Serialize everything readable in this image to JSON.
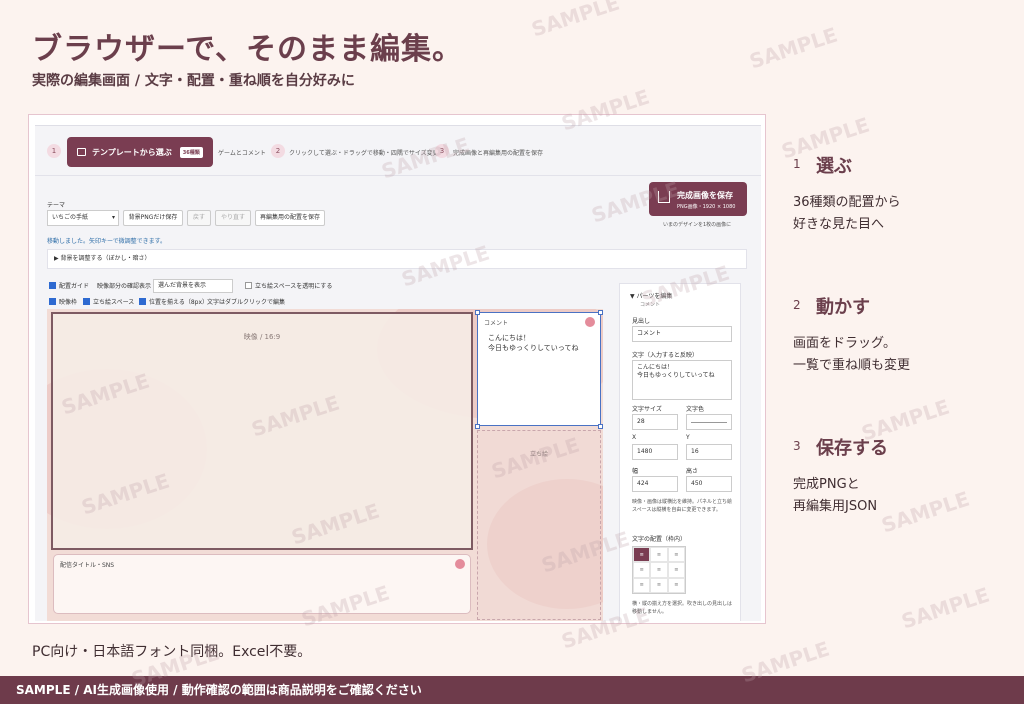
{
  "headline": "ブラウザーで、そのまま編集。",
  "subline": "実際の編集画面 / 文字・配置・重ね順を自分好みに",
  "app": {
    "steps": [
      {
        "num": "1",
        "label": "テンプレートから選ぶ",
        "badge": "36種類"
      },
      {
        "num": "",
        "label": "ゲームとコメント"
      },
      {
        "num": "2",
        "label": "クリックして選ぶ・ドラッグで移動・四隅でサイズ変更"
      },
      {
        "num": "3",
        "label": "完成画像と再編集用の配置を保存"
      }
    ],
    "theme_label": "テーマ",
    "theme_value": "いちごの手紙",
    "buttons": {
      "bg_png": "背景PNGだけ保存",
      "undo": "戻す",
      "redo": "やり直す",
      "save_layout": "再編集用の配置を保存"
    },
    "save_main": {
      "label": "完成画像を保存",
      "sub": "PNG画像・1920 × 1080",
      "note": "いまのデザインを1枚の画像に"
    },
    "moved_msg": "移動しました。矢印キーで微調整できます。",
    "bg_adjust": "▶ 背景を調整する（ぼかし・暗さ）",
    "options": {
      "guide": "配置ガイド",
      "preview_label": "映像部分の確認表示",
      "preview_value": "選んだ背景を表示",
      "transparent": "立ち絵スペースを透明にする",
      "video_frame": "映像枠",
      "stand_space": "立ち絵スペース",
      "align": "位置を揃える（8px）",
      "dblclick_hint": "文字はダブルクリックで編集"
    },
    "canvas": {
      "video_label": "映像 / 16:9",
      "comment_title": "コメント",
      "comment_body": "こんにちは！\n今日もゆっくりしていってね",
      "stand_label": "立ち絵",
      "title_label": "配信タイトル・SNS"
    },
    "panel": {
      "header": "▼ パーツを編集",
      "part_name": "コメント",
      "heading_label": "見出し",
      "heading_value": "コメント",
      "text_label": "文字（入力すると反映）",
      "text_value": "こんにちは！\n今日もゆっくりしていってね",
      "font_size_label": "文字サイズ",
      "font_size_value": "28",
      "color_label": "文字色",
      "x_label": "X",
      "x_value": "1480",
      "y_label": "Y",
      "y_value": "16",
      "w_label": "幅",
      "w_value": "424",
      "h_label": "高さ",
      "h_value": "450",
      "note": "映像・画像は縦横比を維持。パネルと立ち絵スペースは縦横を自由に変更できます。",
      "align_label": "文字の配置（枠内）",
      "align_desc": "横・縦の揃え方を選択。吹き出しの見出しは移動しません。"
    }
  },
  "side": [
    {
      "num": "1",
      "title": "選ぶ",
      "lines": [
        "36種類の配置から",
        "好きな見た目へ"
      ]
    },
    {
      "num": "2",
      "title": "動かす",
      "lines": [
        "画面をドラッグ。",
        "一覧で重ね順も変更"
      ]
    },
    {
      "num": "3",
      "title": "保存する",
      "lines": [
        "完成PNGと",
        "再編集用JSON"
      ]
    }
  ],
  "footer_note": "PC向け・日本語フォント同梱。Excel不要。",
  "bottom_bar": "SAMPLE / AI生成画像使用 / 動作確認の範囲は商品説明をご確認ください",
  "watermark": "SAMPLE",
  "colors": {
    "accent": "#7a3d52",
    "background": "#fcf3ef",
    "bar": "#6e3b4b"
  }
}
